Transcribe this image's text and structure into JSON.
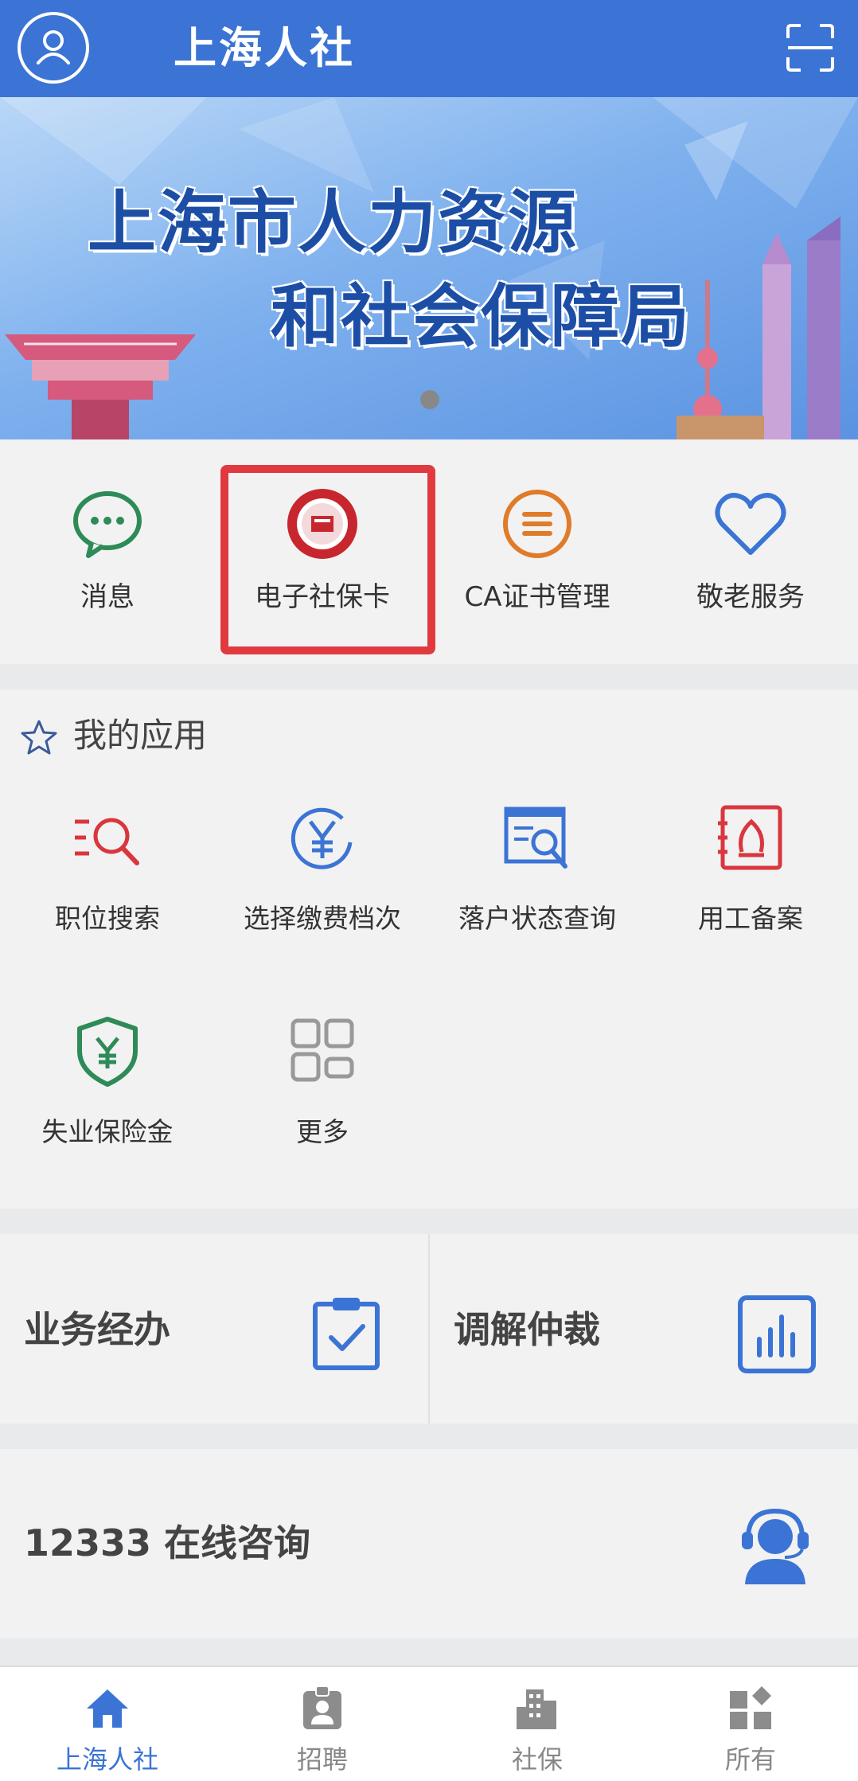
{
  "header": {
    "title": "上海人社"
  },
  "banner": {
    "line1": "上海市人力资源",
    "line2": "和社会保障局"
  },
  "quick": [
    {
      "label": "消息",
      "icon": "message-icon"
    },
    {
      "label": "电子社保卡",
      "icon": "social-security-card-icon"
    },
    {
      "label": "CA证书管理",
      "icon": "ca-certificate-icon"
    },
    {
      "label": "敬老服务",
      "icon": "heart-icon"
    }
  ],
  "my_apps": {
    "title": "我的应用",
    "items": [
      {
        "label": "职位搜索",
        "icon": "job-search-icon"
      },
      {
        "label": "选择缴费档次",
        "icon": "yuan-circle-icon"
      },
      {
        "label": "落户状态查询",
        "icon": "document-search-icon"
      },
      {
        "label": "用工备案",
        "icon": "employee-record-icon"
      },
      {
        "label": "失业保险金",
        "icon": "shield-yuan-icon"
      },
      {
        "label": "更多",
        "icon": "grid-more-icon"
      }
    ]
  },
  "business": [
    {
      "label": "业务经办",
      "icon": "clipboard-check-icon"
    },
    {
      "label": "调解仲裁",
      "icon": "bar-chart-icon"
    }
  ],
  "consult": {
    "label": "12333 在线咨询",
    "icon": "customer-service-icon"
  },
  "tabs": [
    {
      "label": "上海人社",
      "icon": "home-icon",
      "active": true
    },
    {
      "label": "招聘",
      "icon": "badge-icon",
      "active": false
    },
    {
      "label": "社保",
      "icon": "building-icon",
      "active": false
    },
    {
      "label": "所有",
      "icon": "apps-icon",
      "active": false
    }
  ],
  "colors": {
    "primary": "#3b74d4",
    "highlight": "#e03a3f",
    "green": "#2e8b57",
    "orange": "#e07b2a",
    "red": "#d9363e"
  }
}
